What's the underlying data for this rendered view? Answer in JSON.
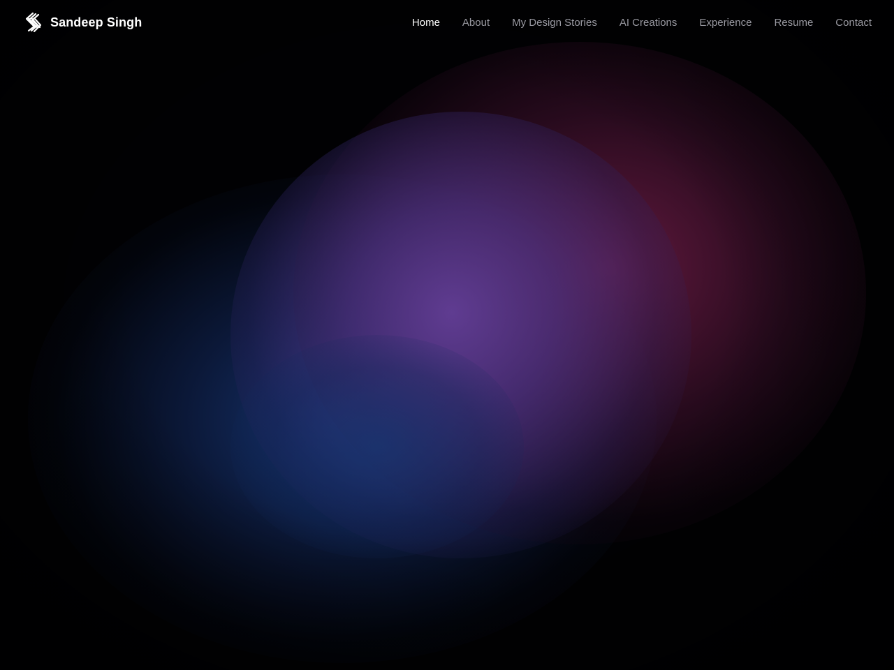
{
  "brand": {
    "name": "Sandeep Singh",
    "logo_icon": "s-stripes-logo-icon"
  },
  "nav": {
    "items": [
      {
        "label": "Home",
        "active": true
      },
      {
        "label": "About",
        "active": false
      },
      {
        "label": "My Design Stories",
        "active": false
      },
      {
        "label": "AI Creations",
        "active": false
      },
      {
        "label": "Experience",
        "active": false
      },
      {
        "label": "Resume",
        "active": false
      },
      {
        "label": "Contact",
        "active": false
      }
    ]
  },
  "theme": {
    "background": "#000000",
    "nav_active_color": "#ffffff",
    "nav_inactive_color": "#9a9aa2",
    "gradient_colors": [
      "#623e96",
      "#6e1c46",
      "#183878"
    ]
  }
}
